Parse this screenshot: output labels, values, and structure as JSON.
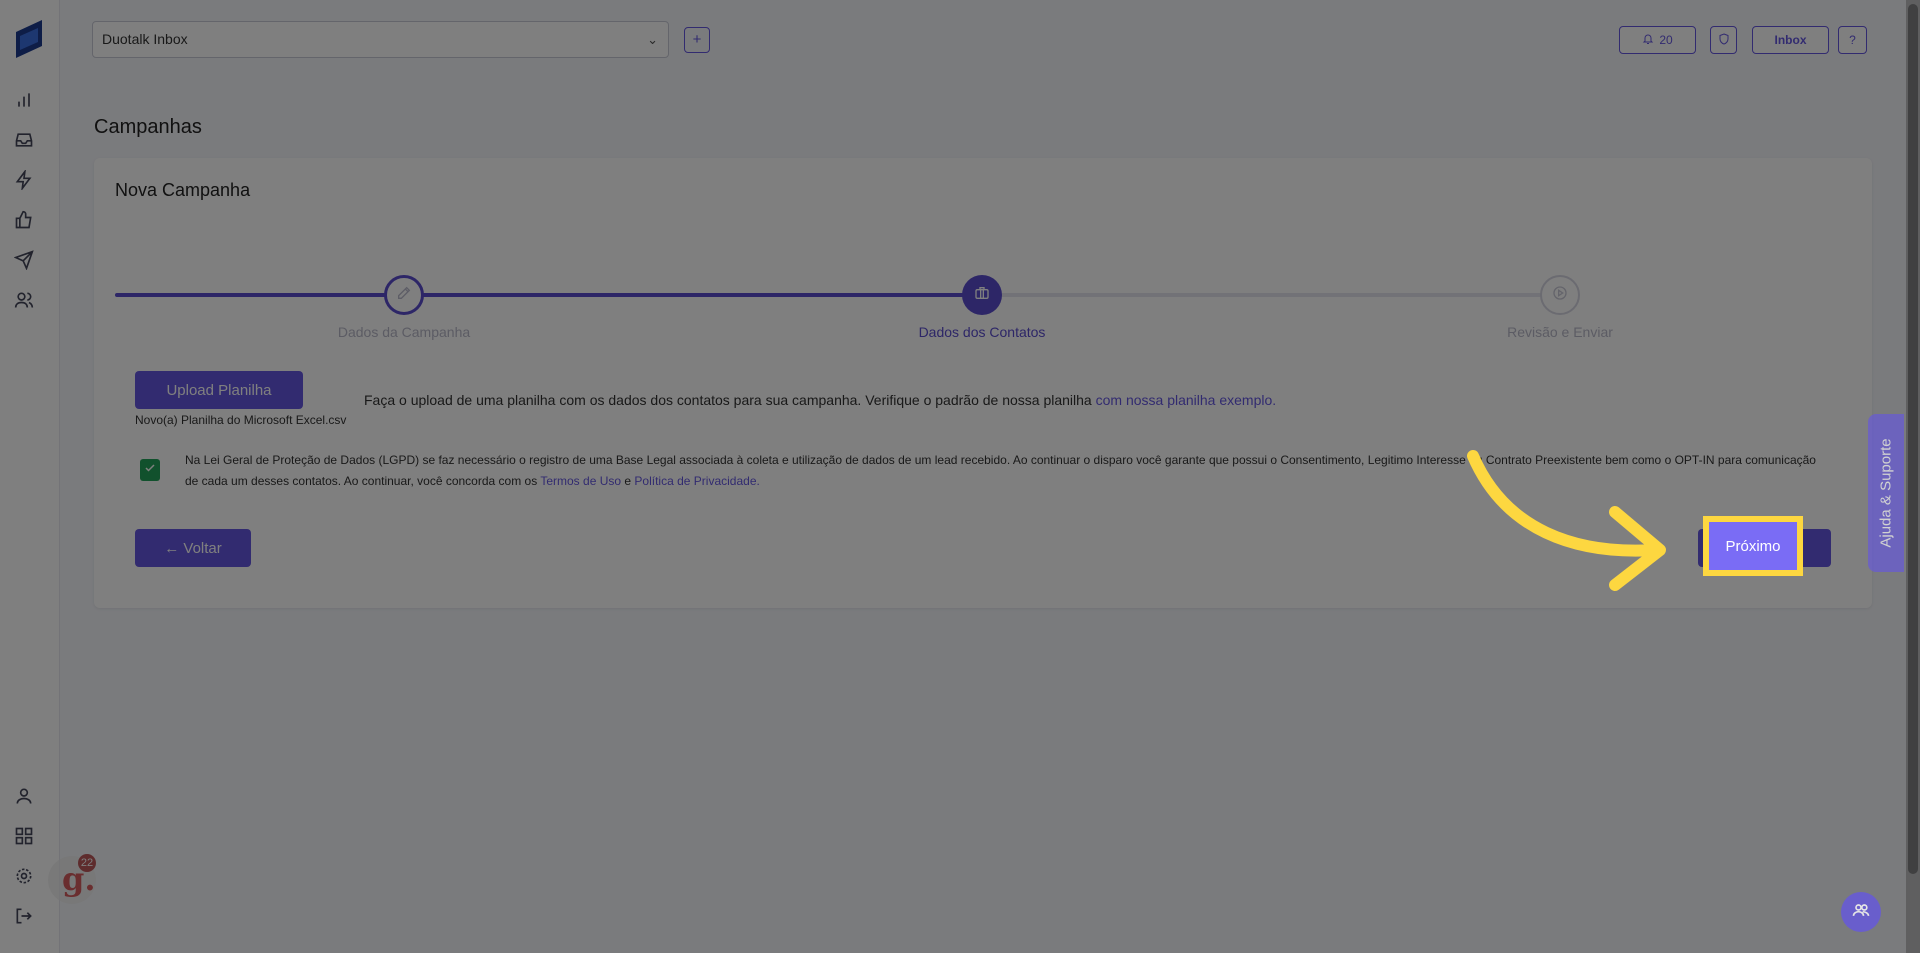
{
  "header": {
    "inbox_select_value": "Duotalk Inbox",
    "notifications_count": "20",
    "inbox_button": "Inbox",
    "help_button": "?"
  },
  "page": {
    "title": "Campanhas",
    "card_title": "Nova Campanha"
  },
  "steps": [
    {
      "label": "Dados da Campanha",
      "state": "done",
      "icon": "edit-icon"
    },
    {
      "label": "Dados dos Contatos",
      "state": "active",
      "icon": "briefcase-icon"
    },
    {
      "label": "Revisão e Enviar",
      "state": "pending",
      "icon": "play-icon"
    }
  ],
  "upload": {
    "button": "Upload Planilha",
    "file_name": "Novo(a) Planilha do Microsoft Excel.csv",
    "text": "Faça o upload de uma planilha com os dados dos contatos para sua campanha. Verifique o padrão de nossa planilha",
    "link": "com nossa planilha exemplo."
  },
  "lgpd": {
    "checked": true,
    "text_1": "Na Lei Geral de Proteção de Dados (LGPD) se faz necessário o registro de uma Base Legal associada à coleta e utilização de dados de um lead recebido. Ao continuar o disparo você garante que possui o Consentimento, Legitimo Interesse",
    "text_hidden": "ou",
    "text_2": "Contrato Preexistente bem como o OPT-IN para comunicação de cada um desses contatos. Ao continuar, você concorda com os",
    "terms_link": "Termos de Uso",
    "and": "e",
    "privacy_link": "Política de Privacidade."
  },
  "actions": {
    "back": "← Voltar",
    "next": "Próximo"
  },
  "support_tab": "Ajuda & Suporte",
  "badge_count": "22",
  "colors": {
    "accent": "#6557e0",
    "highlight": "#fdd740",
    "check": "#22a35a"
  }
}
